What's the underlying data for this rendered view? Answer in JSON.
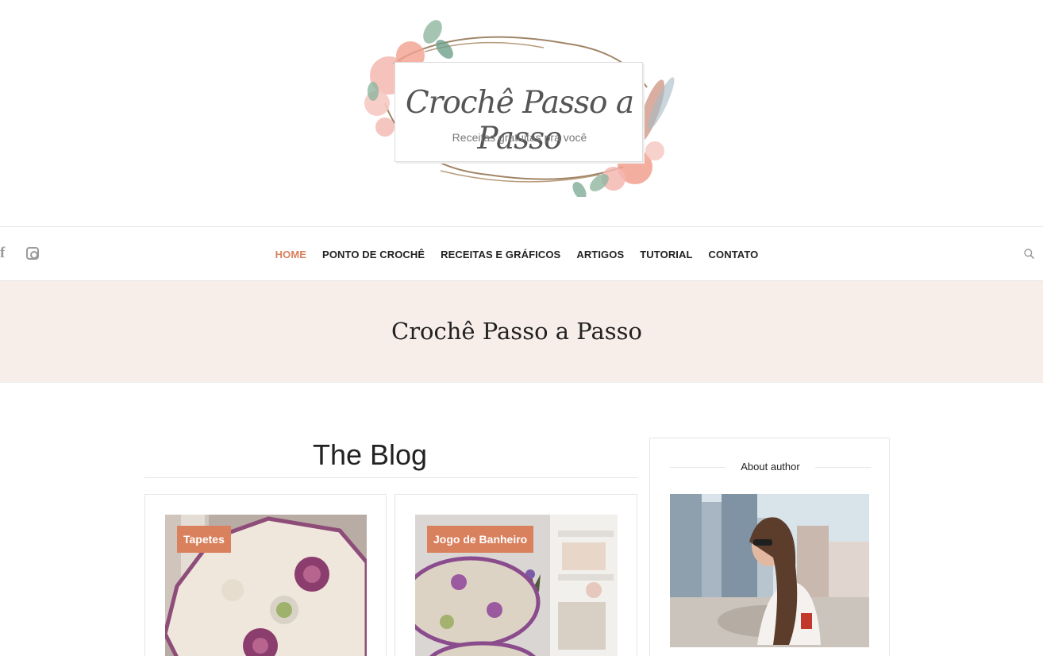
{
  "logo": {
    "title": "Crochê Passo a Passo",
    "subtitle": "Receitas gratuitas pra você"
  },
  "social": {
    "facebook_glyph": "f",
    "icons": [
      "facebook-icon",
      "instagram-icon"
    ]
  },
  "nav": {
    "items": [
      {
        "label": "HOME",
        "active": true
      },
      {
        "label": "PONTO DE CROCHÊ",
        "active": false
      },
      {
        "label": "RECEITAS E GRÁFICOS",
        "active": false
      },
      {
        "label": "ARTIGOS",
        "active": false
      },
      {
        "label": "TUTORIAL",
        "active": false
      },
      {
        "label": "CONTATO",
        "active": false
      }
    ],
    "search_icon": "search-icon"
  },
  "banner": {
    "title": "Crochê Passo a Passo"
  },
  "main": {
    "heading": "The Blog",
    "posts": [
      {
        "category": "Tapetes"
      },
      {
        "category": "Jogo de Banheiro"
      }
    ]
  },
  "sidebar": {
    "widget_title": "About author"
  },
  "colors": {
    "accent": "#d9805d",
    "banner_bg": "#f7ede9",
    "text": "#222222",
    "muted": "#9a9a9a"
  }
}
